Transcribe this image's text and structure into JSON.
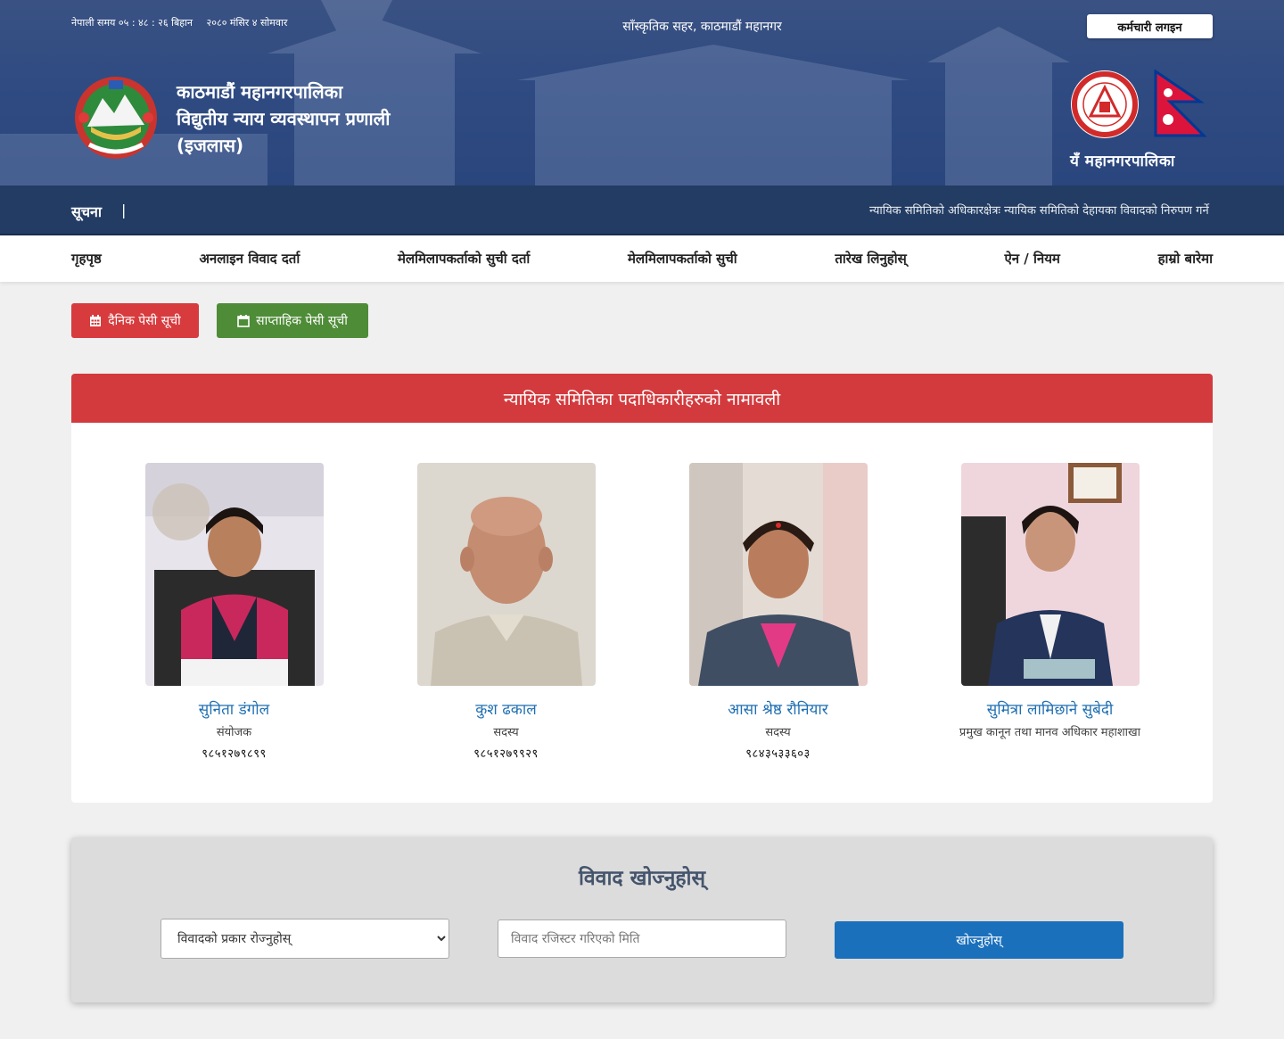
{
  "header": {
    "nepali_time": "नेपाली समय ०५ : ४८ : २६ बिहान",
    "nepali_date": "२०८० मंसिर ४ सोमवार",
    "tagline": "साँस्कृतिक सहर, काठमाडौं महानगर",
    "login_label": "कर्मचारी लगइन",
    "org_line1": "काठमाडौं महानगरपालिका",
    "org_line2": "विद्युतीय न्याय व्यवस्थापन प्रणाली",
    "org_line3": "(इजलास)",
    "script_text": "यँ महानगरपालिका"
  },
  "notice": {
    "label": "सूचना",
    "separator": "|",
    "text": "न्यायिक समितिको अधिकारक्षेत्रः न्यायिक समितिको देहायका विवादको निरुपण गर्ने अधिकार"
  },
  "nav": {
    "items": [
      "गृहपृष्ठ",
      "अनलाइन विवाद दर्ता",
      "मेलमिलापकर्ताको सुची दर्ता",
      "मेलमिलापकर्ताको सुची",
      "तारेख लिनुहोस्",
      "ऐन / नियम",
      "हाम्रो बारेमा"
    ]
  },
  "quick_buttons": {
    "daily": "दैनिक पेसी सूची",
    "weekly": "साप्ताहिक पेसी सूची"
  },
  "committee": {
    "title": "न्यायिक समितिका पदाधिकारीहरुको नामावली",
    "members": [
      {
        "name": "सुनिता डंगोल",
        "role": "संयोजक",
        "phone": "९८५१२७९८९९"
      },
      {
        "name": "कुश ढकाल",
        "role": "सदस्य",
        "phone": "९८५१२७९९२९"
      },
      {
        "name": "आसा श्रेष्ठ रौनियार",
        "role": "सदस्य",
        "phone": "९८४३५३३६०३"
      },
      {
        "name": "सुमित्रा लामिछाने सुबेदी",
        "role": "प्रमुख कानून तथा मानव अधिकार महाशाखा",
        "phone": ""
      }
    ]
  },
  "search": {
    "title": "विवाद खोज्नुहोस्",
    "select_value": "विवादको प्रकार रोज्नुहोस्",
    "date_placeholder": "विवाद रजिस्टर गरिएको मिति",
    "button_label": "खोज्नुहोस्"
  },
  "colors": {
    "header_blue": "#2f4b82",
    "notice_bar": "#223c63",
    "red": "#d33a3d",
    "green": "#4e8c37",
    "link_blue": "#1f6fb2",
    "search_btn": "#1b70bc"
  },
  "icons": [
    "calendar-grid-icon",
    "calendar-icon",
    "nepal-emblem-icon",
    "kmc-logo-icon",
    "nepal-flag-icon"
  ]
}
